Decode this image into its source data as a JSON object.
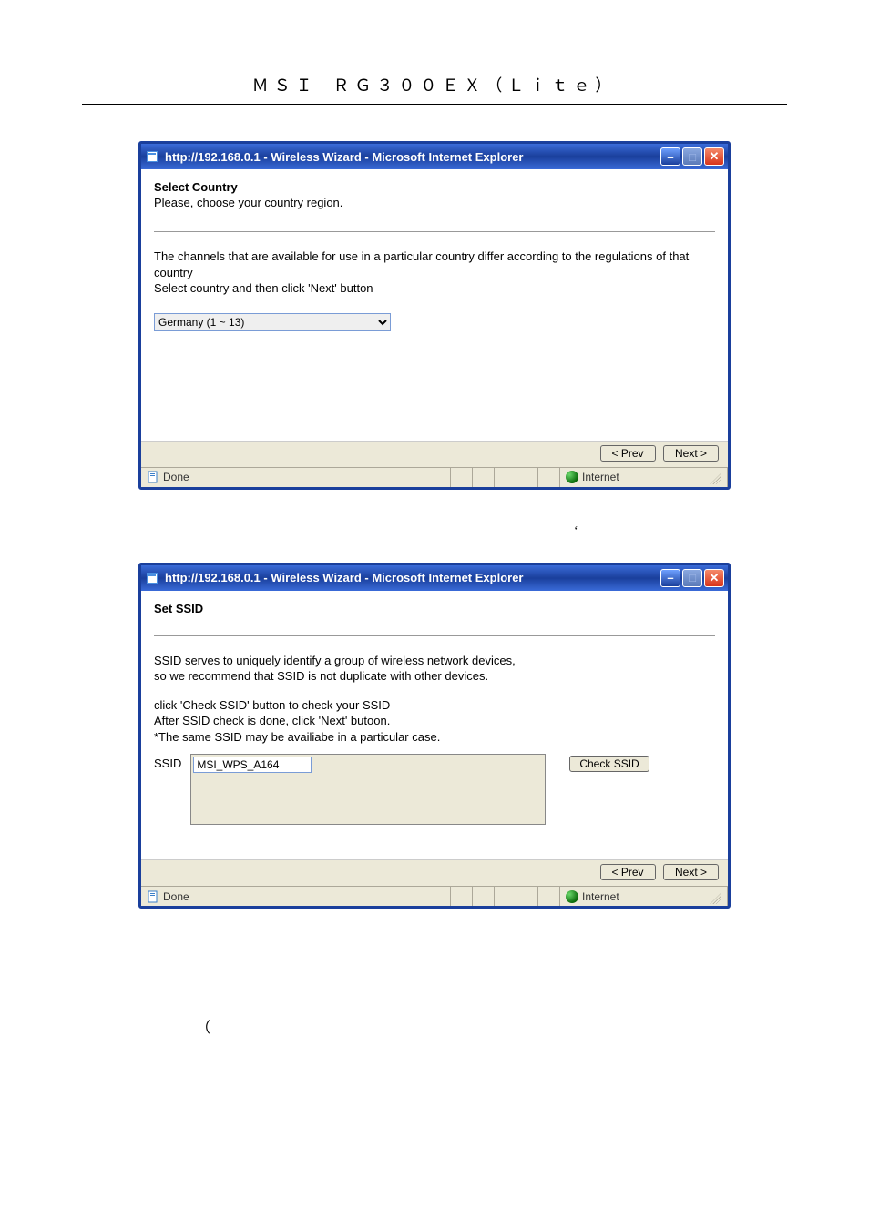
{
  "header": {
    "title": "ＭＳＩ ＲＧ３００ＥＸ（Ｌｉｔｅ）"
  },
  "marks": {
    "apostrophe": "‘",
    "paren": "（"
  },
  "window1": {
    "title": "http://192.168.0.1 - Wireless Wizard - Microsoft Internet Explorer",
    "heading": "Select Country",
    "sub": "Please, choose your country region.",
    "body1": "The channels that are available for use in a particular country differ according to the regulations of that country",
    "body2": "Select country and then click 'Next' button",
    "country_value": "Germany (1 ~ 13)",
    "prev": "< Prev",
    "next": "Next >",
    "status_done": "Done",
    "status_zone": "Internet"
  },
  "window2": {
    "title": "http://192.168.0.1 - Wireless Wizard - Microsoft Internet Explorer",
    "heading": "Set SSID",
    "body1": "SSID serves to uniquely identify a group of wireless network devices,",
    "body2": "so we recommend that SSID is not duplicate with other devices.",
    "body3": "click 'Check SSID' button to check your SSID",
    "body4": "After SSID check is done, click 'Next' butoon.",
    "body5": "*The same SSID may be availiabe in a particular case.",
    "ssid_label": "SSID",
    "ssid_value": "MSI_WPS_A164",
    "check_label": "Check SSID",
    "prev": "< Prev",
    "next": "Next >",
    "status_done": "Done",
    "status_zone": "Internet"
  }
}
